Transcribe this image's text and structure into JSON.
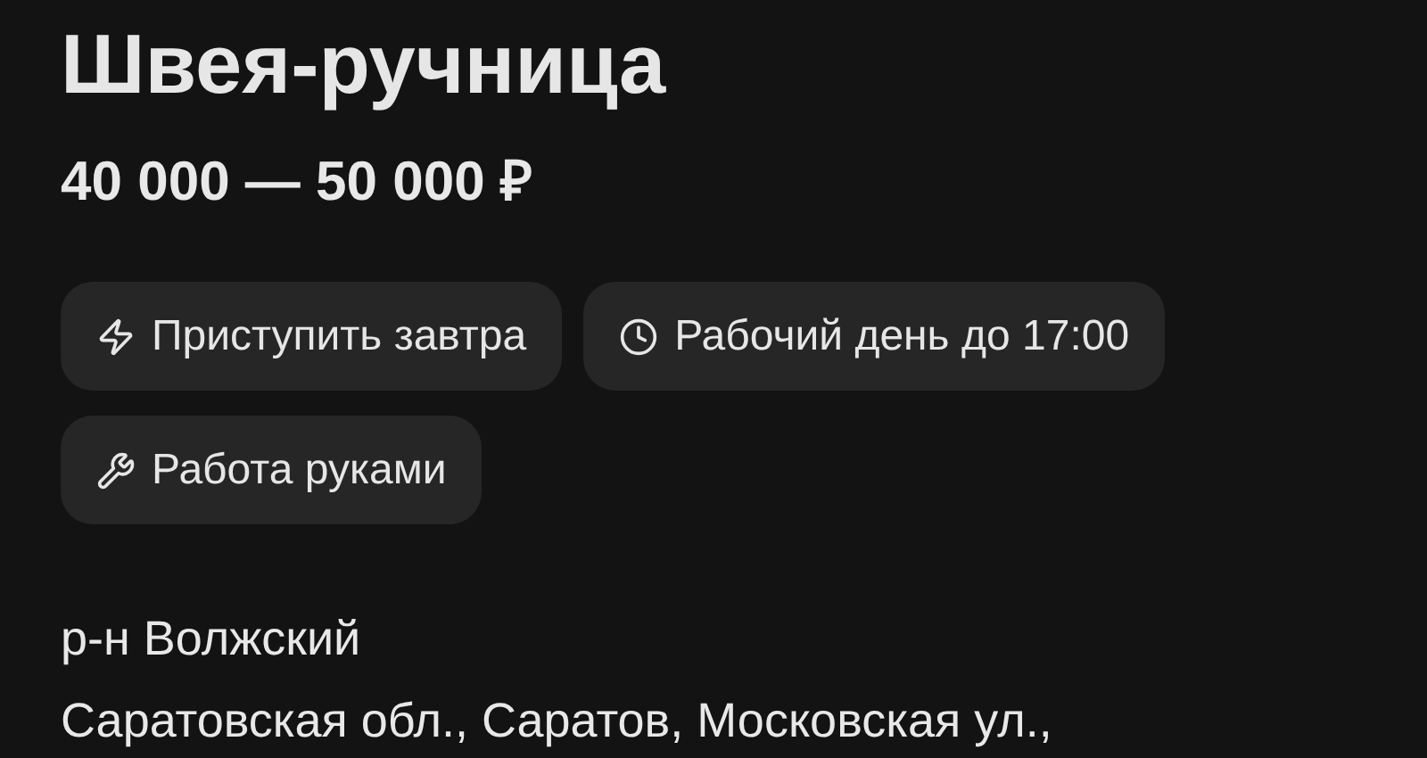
{
  "title": "Швея-ручница",
  "salary": "40 000 — 50 000 ₽",
  "tags": [
    {
      "kind": "lightning",
      "label": "Приступить завтра"
    },
    {
      "kind": "clock",
      "label": "Рабочий день до 17:00"
    },
    {
      "kind": "wrench",
      "label": "Работа руками"
    }
  ],
  "address": {
    "district": "р-н Волжский",
    "line": "Саратовская обл., Саратов, Московская ул.,"
  }
}
